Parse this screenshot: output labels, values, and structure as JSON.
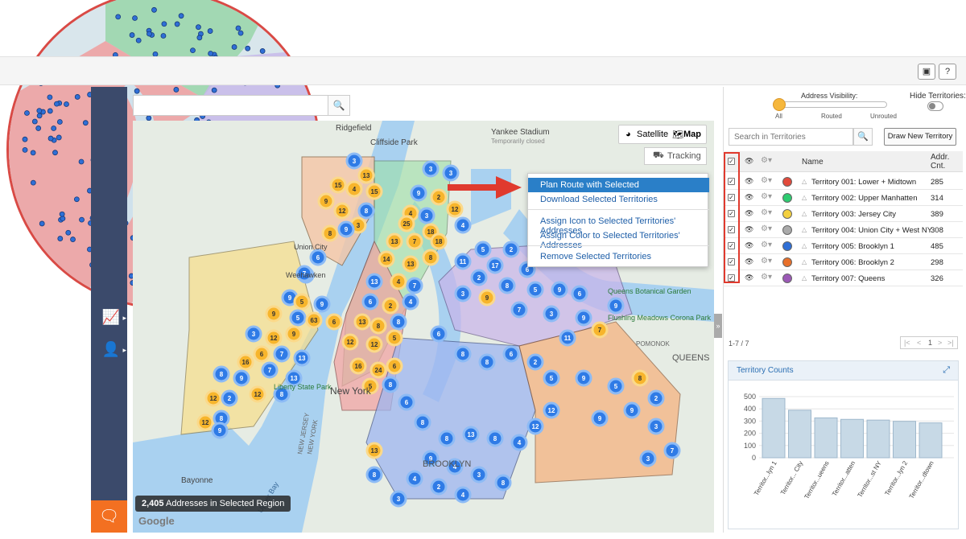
{
  "topbar": {
    "video_icon": "video-camera-icon",
    "help_label": "?"
  },
  "map": {
    "search_placeholder": "",
    "view_toggle": {
      "satellite": "Satellite",
      "map": "Map"
    },
    "tracking_label": "Tracking",
    "status": {
      "count": "2,405",
      "text": "Addresses in Selected Region"
    },
    "google": "Google",
    "labels": [
      {
        "text": "Ridgefield"
      },
      {
        "text": "Cliffside Park"
      },
      {
        "text": "Yankee Stadium"
      },
      {
        "text": "Temporarily closed"
      },
      {
        "text": "Union City"
      },
      {
        "text": "Weehawken"
      },
      {
        "text": "Liberty State Park"
      },
      {
        "text": "Bayonne"
      },
      {
        "text": "QUEENS"
      },
      {
        "text": "Queens Botanical Garden"
      },
      {
        "text": "Flushing Meadows Corona Park"
      },
      {
        "text": "POMONOK"
      },
      {
        "text": "New York"
      },
      {
        "text": "BROOKLYN"
      },
      {
        "text": "Upper Bay"
      },
      {
        "text": "NEW JERSEY"
      },
      {
        "text": "NEW YORK"
      }
    ]
  },
  "context_menu": {
    "items": [
      "Plan Route with Selected",
      "Download Selected Territories",
      "Assign Icon to Selected Territories' Addresses",
      "Assign Color to Selected Territories' Addresses",
      "Remove Selected Territories"
    ]
  },
  "visibility": {
    "label": "Address Visibility:",
    "ticks": [
      "All",
      "Routed",
      "Unrouted"
    ],
    "hide_label": "Hide Territories:"
  },
  "territories_panel": {
    "search_placeholder": "Search in Territories",
    "draw_button": "Draw New Territory",
    "columns": {
      "name": "Name",
      "count": "Addr. Cnt."
    },
    "rows": [
      {
        "name": "Territory 001: Lower + Midtown",
        "count": "285",
        "color": "#e24a3b"
      },
      {
        "name": "Territory 002: Upper Manhatten",
        "count": "314",
        "color": "#2ecc71"
      },
      {
        "name": "Territory 003: Jersey City",
        "count": "389",
        "color": "#f4d03f"
      },
      {
        "name": "Territory 004: Union City + West NY",
        "count": "308",
        "color": "#aaaaaa"
      },
      {
        "name": "Territory 005: Brooklyn 1",
        "count": "485",
        "color": "#2f6fd6"
      },
      {
        "name": "Territory 006: Brooklyn 2",
        "count": "298",
        "color": "#e8702a"
      },
      {
        "name": "Territory 007: Queens",
        "count": "326",
        "color": "#9b59b6"
      }
    ],
    "pager_info": "1-7 / 7",
    "pager": [
      "|<",
      "<",
      "1",
      ">",
      ">|"
    ]
  },
  "chart_card": {
    "title": "Territory Counts"
  },
  "chart_data": {
    "type": "bar",
    "title": "Territory Counts",
    "categories": [
      "Territor...lyn 1",
      "Territor... City",
      "Territor...ueens",
      "Territor...atten",
      "Territor...st NY",
      "Territor...lyn 2",
      "Territor...dtown"
    ],
    "values": [
      485,
      389,
      326,
      314,
      308,
      298,
      285
    ],
    "yticks": [
      "0",
      "100",
      "200",
      "300",
      "400",
      "500"
    ],
    "ylim": [
      0,
      500
    ],
    "bar_color": "#c7d9e6",
    "grid": true
  },
  "colors": {
    "nav": "#3b4a6b",
    "accent": "#2a7fc8",
    "chat": "#f37021",
    "cluster_blue": "#2f7be6",
    "cluster_orange": "#f7b52c"
  }
}
